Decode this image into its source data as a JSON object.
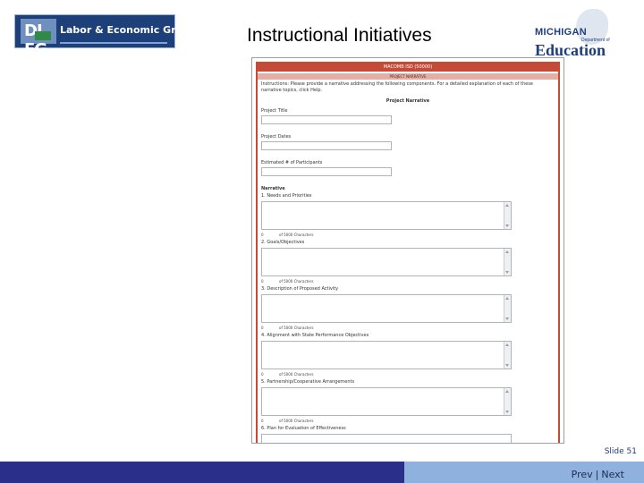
{
  "header": {
    "title": "Instructional Initiatives",
    "left_logo": {
      "initials": "DL EG",
      "text": "Labor & Economic Growth",
      "colors": {
        "bg": "#1d3f7a",
        "accent": "#2f8a45"
      }
    },
    "right_logo": {
      "state": "MICHIGAN",
      "dept": "Department of",
      "org": "Education",
      "color": "#1f3f7b"
    }
  },
  "form": {
    "heading": "MACOMB ISD (50000)",
    "subheading": "PROJECT NARRATIVE",
    "instructions": "Instructions: Please provide a narrative addressing the following components. For a detailed explanation of each of these narrative topics, click Help.",
    "section_title": "Project Narrative",
    "fields": [
      {
        "label": "Project Title",
        "value": ""
      },
      {
        "label": "Project Dates",
        "value": ""
      },
      {
        "label": "Estimated # of Participants",
        "value": ""
      }
    ],
    "narrative_title": "Narrative",
    "narrative_items": [
      {
        "label": "1. Needs and Priorities",
        "count_value": "0",
        "count_text": "of 5000 Characters"
      },
      {
        "label": "2. Goals/Objectives",
        "count_value": "0",
        "count_text": "of 5000 Characters"
      },
      {
        "label": "3. Description of Proposed Activity",
        "count_value": "0",
        "count_text": "of 5000 Characters"
      },
      {
        "label": "4. Alignment with State Performance Objectives",
        "count_value": "0",
        "count_text": "of 5000 Characters"
      },
      {
        "label": "5. Partnership/Cooperative Arrangements",
        "count_value": "0",
        "count_text": "of 5000 Characters"
      }
    ],
    "last_label": "6. Plan for Evaluation of Effectiveness",
    "colors": {
      "accent": "#c44b38",
      "subheader": "#e4b0a6"
    }
  },
  "footer": {
    "slide": "Slide 51",
    "nav_prev": "Prev",
    "nav_sep": "|",
    "nav_next": "Next",
    "colors": {
      "left": "#2a2f8a",
      "right": "#8fb1de"
    }
  }
}
